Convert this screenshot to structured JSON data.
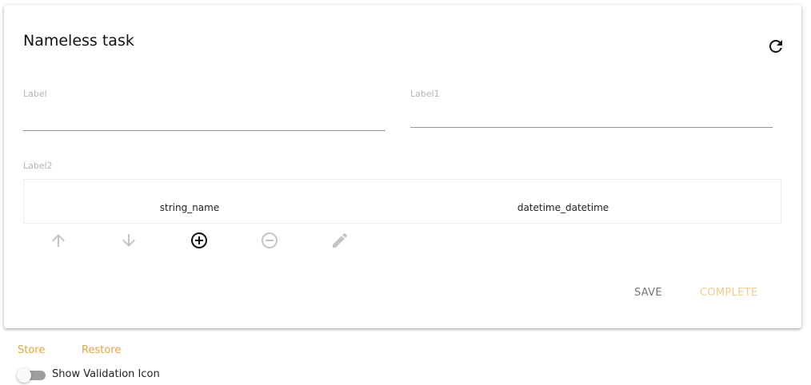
{
  "task": {
    "title": "Nameless task"
  },
  "form": {
    "label": {
      "label": "Label",
      "value": ""
    },
    "label1": {
      "label": "Label1",
      "value": ""
    },
    "label2": {
      "label": "Label2"
    }
  },
  "table": {
    "columns": [
      "string_name",
      "datetime_datetime"
    ],
    "actions": [
      {
        "icon": "arrow-up-icon",
        "enabled": false
      },
      {
        "icon": "arrow-down-icon",
        "enabled": false
      },
      {
        "icon": "add-circle-icon",
        "enabled": true
      },
      {
        "icon": "remove-circle-icon",
        "enabled": false
      },
      {
        "icon": "edit-pencil-icon",
        "enabled": false
      }
    ]
  },
  "buttons": {
    "save": "SAVE",
    "complete": "COMPLETE"
  },
  "footer": {
    "store": "Store",
    "restore": "Restore",
    "toggle_label": "Show Validation Icon",
    "toggle_on": false
  },
  "colors": {
    "accent": "#e6a43a",
    "complete_disabled": "#f3cc8d",
    "save": "#757575",
    "icon_disabled": "#c4c4c4",
    "icon_enabled": "#111111"
  },
  "icons": {
    "refresh": "refresh-icon"
  }
}
